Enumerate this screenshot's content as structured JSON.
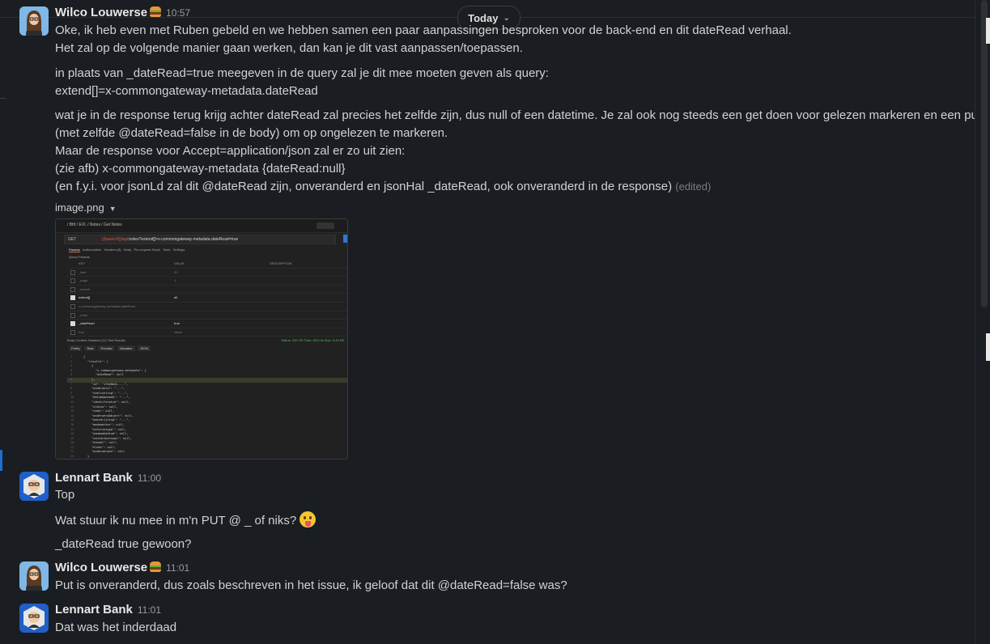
{
  "date_pill": "Today",
  "messages": [
    {
      "author": "Wilco Louwerse",
      "time": "10:57",
      "lines": [
        "Oke, ik heb even met Ruben gebeld en we hebben samen een paar aanpassingen besproken voor de back-end en dit dateRead verhaal.",
        "Het zal op de volgende manier gaan werken, dan kan je dit vast aanpassen/toepassen.",
        "in plaats van _dateRead=true meegeven in de query zal je dit mee moeten geven als query:",
        "extend[]=x-commongateway-metadata.dateRead",
        "wat je in de response terug krijg achter dateRead zal precies het zelfde zijn, dus null of een datetime. Je zal ook nog steeds een get doen voor gelezen markeren en een put",
        "(met zelfde @dateRead=false in de body) om op ongelezen te markeren.",
        "Maar de response voor Accept=application/json zal er zo uit zien:",
        "(zie afb) x-commongateway-metadata {dateRead:null}",
        "(en f.y.i. voor jsonLd zal dit @dateRead zijn, onveranderd en jsonHal _dateRead, ook onveranderd in de response)"
      ],
      "edited": "(edited)",
      "attachment": {
        "filename": "image.png",
        "breadcrumb": "/ Bfd / EVL / Notes / Get Notes",
        "method": "GET",
        "url_prefix": "{{baseUrl}}/api/",
        "url_rest": "notes?extend[]=x-commongateway-metadata.dateRead=true",
        "tabs": [
          "Params",
          "Authorization",
          "Headers (8)",
          "Body",
          "Pre-request Script",
          "Tests",
          "Settings"
        ],
        "section": "Query Params",
        "columns": [
          "KEY",
          "VALUE",
          "DESCRIPTION"
        ],
        "params": [
          {
            "key": "_limit",
            "value": "20",
            "checked": false
          },
          {
            "key": "_page",
            "value": "1",
            "checked": false
          },
          {
            "key": "_search",
            "value": "",
            "checked": false
          },
          {
            "key": "extend[]",
            "value": "all",
            "checked": true
          },
          {
            "key": "x-commongateway-metadata.dateRead",
            "value": "",
            "checked": false
          },
          {
            "key": "_order",
            "value": "",
            "checked": false
          },
          {
            "key": "_dateRead",
            "value": "true",
            "checked": true
          },
          {
            "key": "Key",
            "value": "Value",
            "checked": false
          }
        ],
        "response_tabs": "Body  Cookies  Headers (11)  Test Results",
        "status": "Status: 200 OK   Time: 823 ms   Size: 8.49 KB",
        "formats": [
          "Pretty",
          "Raw",
          "Preview",
          "Visualize",
          "JSON"
        ],
        "code": [
          "{",
          "\"results\": [",
          "{",
          "\"x-commongateway-metadata\": {",
          "\"dateRead\": null",
          "},",
          "\"id\": \"1f4e0b4c-...\",",
          "\"onderwerp\": \"...\",",
          "\"toelichting\": \"...\",",
          "\"datumAanmaak\": \"...\",",
          "\"identificatie\": null,",
          "\"status\": null,",
          "\"zaak\": null,",
          "\"onderwerpObject\": null,",
          "\"omschrijving\": \"...\",",
          "\"medewerker\": null,",
          "\"notitietype\": null,",
          "\"aanmaakdatum\": null,",
          "\"contactpersoon\": null,",
          "\"kanaal\": null,",
          "\"klant\": null,",
          "\"onderwerpen\": null",
          "}",
          "]"
        ]
      }
    },
    {
      "author": "Lennart Bank",
      "time": "11:00",
      "lines": [
        "Top",
        "Wat stuur ik nu mee in m'n PUT @ _ of niks?",
        "_dateRead true gewoon?"
      ]
    },
    {
      "author": "Wilco Louwerse",
      "time": "11:01",
      "lines": [
        "Put is onveranderd, dus zoals beschreven in het issue, ik geloof dat dit @dateRead=false was?"
      ]
    },
    {
      "author": "Lennart Bank",
      "time": "11:01",
      "lines": [
        "Dat was het inderdaad"
      ]
    }
  ],
  "colors": {
    "background": "#1a1d21",
    "accent": "#1d6fd1",
    "text": "#d1d2d3"
  },
  "icons": [
    "burger-emoji-icon",
    "tongue-emoji-icon",
    "chevron-down-icon"
  ]
}
